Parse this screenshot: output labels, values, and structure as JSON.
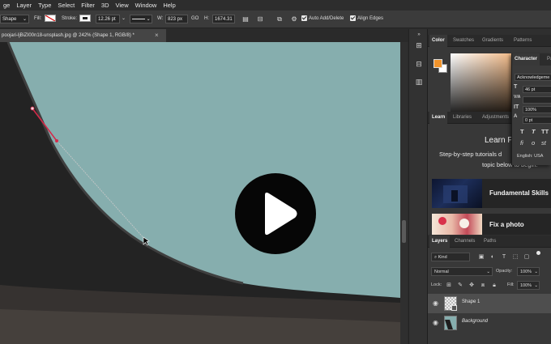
{
  "menubar": {
    "items": [
      "ge",
      "Layer",
      "Type",
      "Select",
      "Filter",
      "3D",
      "View",
      "Window",
      "Help"
    ]
  },
  "options": {
    "tool_mode": "Shape",
    "fill_label": "Fill:",
    "stroke_label": "Stroke:",
    "stroke_width": "12.26 pt",
    "w_label": "W:",
    "w_value": "823 px",
    "link_label": "GO",
    "h_label": "H:",
    "h_value": "1674.31",
    "auto_add_delete": "Auto Add/Delete",
    "align_edges": "Align Edges"
  },
  "document": {
    "tab_title": "poojari-ljBiZI00n18-unsplash.jpg @ 242% (Shape 1, RGB/8) *",
    "close_glyph": "×"
  },
  "color_panel": {
    "tabs": [
      "Color",
      "Swatches",
      "Gradients",
      "Patterns"
    ],
    "foreground": "#f0932b",
    "background": "#ffffff"
  },
  "character_panel": {
    "tabs": [
      "Character",
      "Pa"
    ],
    "font_family": "Acknowledgeme",
    "font_size": "46 pt",
    "tracking": "100%",
    "baseline_shift": "0 pt",
    "language": "English: USA",
    "glyph_row1": [
      "T",
      "T",
      "TT"
    ],
    "glyph_row2": [
      "fi",
      "o",
      "st"
    ]
  },
  "learn_panel": {
    "tabs": [
      "Learn",
      "Libraries",
      "Adjustments"
    ],
    "title": "Learn P",
    "desc_line1": "Step-by-step tutorials d",
    "desc_line2": "topic below to begin.",
    "cards": [
      {
        "label": "Fundamental Skills"
      },
      {
        "label": "Fix a photo"
      }
    ]
  },
  "layers_panel": {
    "tabs": [
      "Layers",
      "Channels",
      "Paths"
    ],
    "filter_kind": "Kind",
    "blend_mode": "Normal",
    "opacity_label": "Opacity:",
    "opacity_value": "100%",
    "lock_label": "Lock:",
    "fill_label": "Fill:",
    "fill_value": "100%",
    "layers": [
      {
        "name": "Shape 1",
        "selected": true
      },
      {
        "name": "Background",
        "selected": false
      }
    ]
  }
}
